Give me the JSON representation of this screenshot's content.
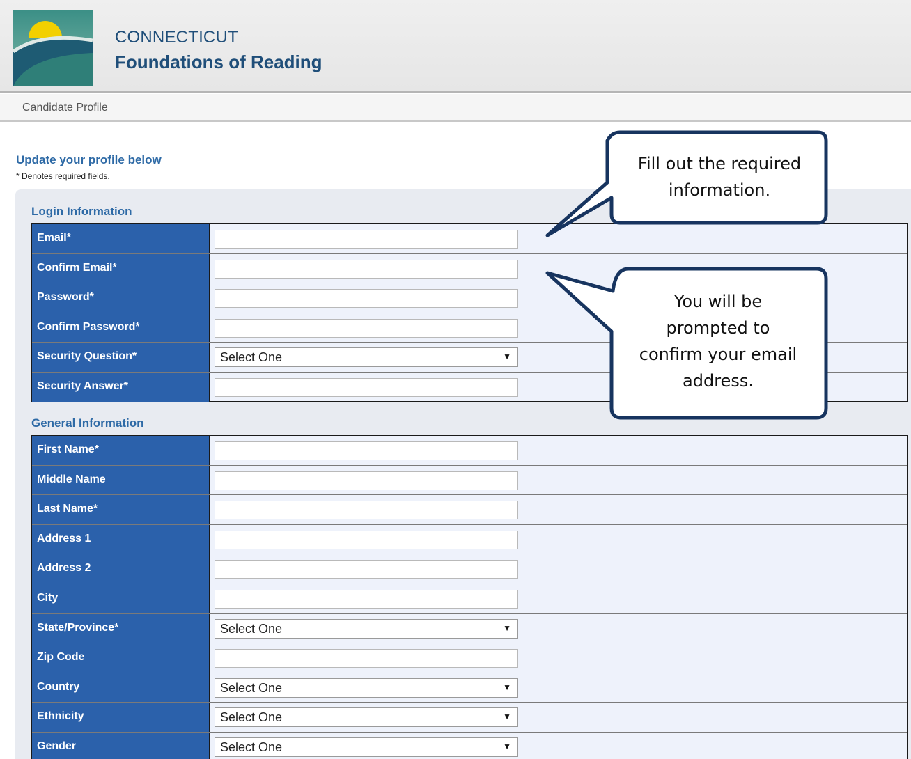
{
  "header": {
    "brand_line1": "CONNECTICUT",
    "brand_line2": "Foundations of Reading",
    "logo_icon": "sunrise-logo-icon"
  },
  "breadcrumb": "Candidate Profile",
  "form": {
    "title": "Update your profile below",
    "note": "* Denotes required fields."
  },
  "login_section": {
    "title": "Login Information",
    "fields": [
      {
        "label": "Email*",
        "type": "text",
        "value": ""
      },
      {
        "label": "Confirm Email*",
        "type": "text",
        "value": ""
      },
      {
        "label": "Password*",
        "type": "text",
        "value": ""
      },
      {
        "label": "Confirm Password*",
        "type": "text",
        "value": ""
      },
      {
        "label": "Security Question*",
        "type": "select",
        "value": "Select One"
      },
      {
        "label": "Security Answer*",
        "type": "text",
        "value": ""
      }
    ]
  },
  "general_section": {
    "title": "General Information",
    "fields": [
      {
        "label": "First Name*",
        "type": "text",
        "value": ""
      },
      {
        "label": "Middle Name",
        "type": "text",
        "value": ""
      },
      {
        "label": "Last Name*",
        "type": "text",
        "value": ""
      },
      {
        "label": "Address 1",
        "type": "text",
        "value": ""
      },
      {
        "label": "Address 2",
        "type": "text",
        "value": ""
      },
      {
        "label": "City",
        "type": "text",
        "value": ""
      },
      {
        "label": "State/Province*",
        "type": "select",
        "value": "Select One"
      },
      {
        "label": "Zip Code",
        "type": "text",
        "value": ""
      },
      {
        "label": "Country",
        "type": "select",
        "value": "Select One"
      },
      {
        "label": "Ethnicity",
        "type": "select",
        "value": "Select One"
      },
      {
        "label": "Gender",
        "type": "select",
        "value": "Select One"
      }
    ]
  },
  "callouts": {
    "required": "Fill out the required information.",
    "confirm_email": "You will be prompted to confirm your email address."
  },
  "colors": {
    "brand": "#1f4e79",
    "label_bg": "#2b61ab",
    "section_title": "#2e6aa6",
    "callout_border": "#17345f"
  }
}
